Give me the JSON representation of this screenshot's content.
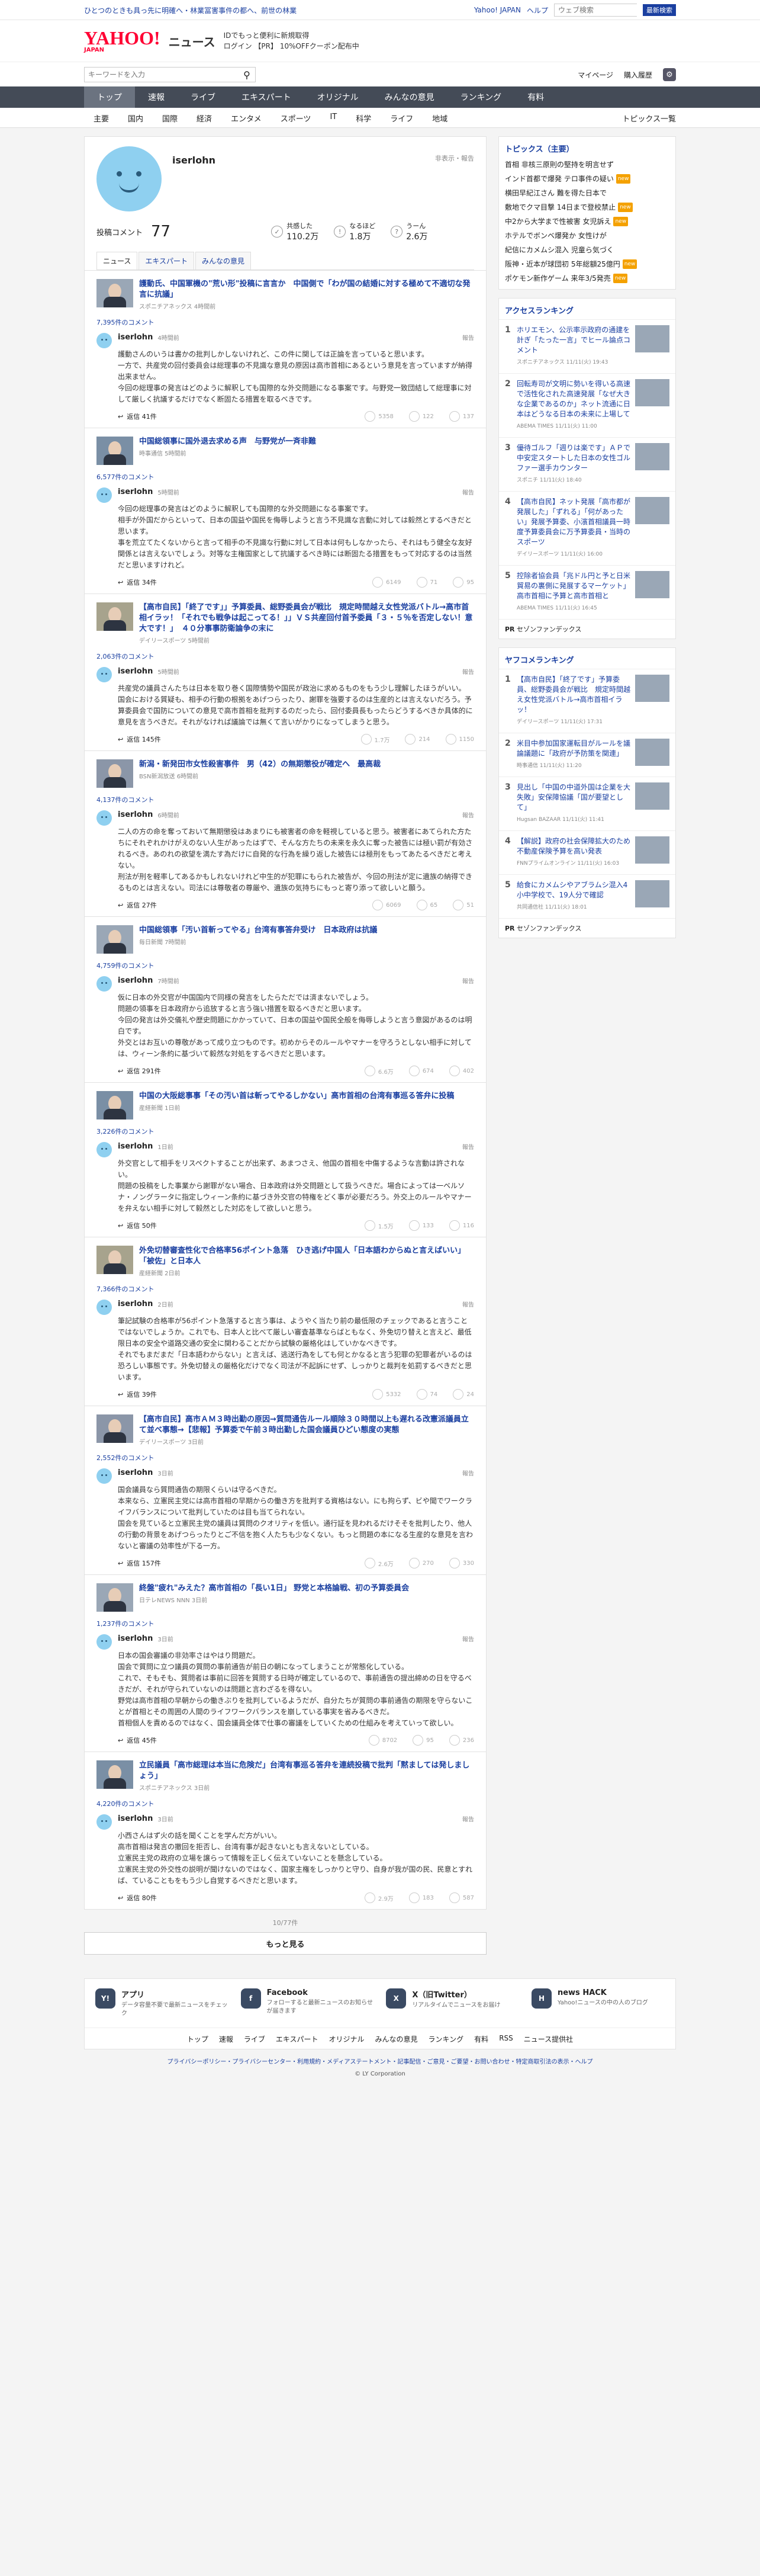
{
  "topline": {
    "left": "ひとつのときも具っ先に明確へ・林業冨害事件の都へ、前世の林業",
    "right": [
      "Yahoo! JAPAN",
      "ヘルプ"
    ],
    "search_placeholder": "ウェブ検索",
    "search_btn": "最新検索"
  },
  "header": {
    "logo": "YAHOO!",
    "logo_sub": "JAPAN",
    "section": "ニュース",
    "promo1": "IDでもっと便利に新規取得",
    "promo2": "ログイン 【PR】 10%OFFクーポン配布中"
  },
  "searchbar": {
    "placeholder": "キーワードを入力",
    "account": "マイページ",
    "purchase": "購入履歴"
  },
  "gnav": [
    "トップ",
    "速報",
    "ライブ",
    "エキスパート",
    "オリジナル",
    "みんなの意見",
    "ランキング",
    "有料"
  ],
  "snav": {
    "items": [
      "主要",
      "国内",
      "国際",
      "経済",
      "エンタメ",
      "スポーツ",
      "IT",
      "科学",
      "ライフ",
      "地域"
    ],
    "all": "トピックス一覧"
  },
  "profile": {
    "name": "iserlohn",
    "follow": "非表示・報告",
    "comments_label": "投稿コメント",
    "comments_count": "77",
    "stats": [
      {
        "label": "共感した",
        "value": "110.2万"
      },
      {
        "label": "なるほど",
        "value": "1.8万"
      },
      {
        "label": "うーん",
        "value": "2.6万"
      }
    ],
    "tabs": [
      "ニュース",
      "エキスパート",
      "みんなの意見"
    ]
  },
  "items": [
    {
      "title": "護動氏、中国軍機の\"荒い形\"投稿に言言か　中国側で「わが国の結婚に対する極めて不適切な発言に抗議」",
      "src": "スポニチアネックス 4時間前",
      "count": "7,395件のコメント",
      "user": "iserlohn",
      "time": "4時間前",
      "report": "報告",
      "text": "護動さんのいうは書かの批判しかしないけれど、この件に関しては正論を言っていると思います。\n一方で、共産党の回付委員会は総理事の不見識な意見の原因は高市首相にあるという意見を言っていますが納得出来ません。\n今回の総理事の発言はどのように解釈しても国際的な外交問題になる事案です。与野党一致団結して総理事に対して厳しく抗議するだけでなく断固たる措置を取るべきです。",
      "replies": "返信 41件",
      "votes": [
        "5358",
        "122",
        "137"
      ]
    },
    {
      "title": "中国総領事に国外退去求める声　与野党が一斉非難",
      "src": "時事通信 5時間前",
      "count": "6,577件のコメント",
      "user": "iserlohn",
      "time": "5時間前",
      "report": "報告",
      "text": "今回の総理事の発言はどのように解釈しても国際的な外交問題になる事案です。\n相手が外国だからといって、日本の国益や国民を侮辱しようと言う不見識な言動に対しては毅然とするべきだと思います。\n事を荒立てたくないからと言って相手の不見識な行動に対して日本は何もしなかったら、それはもう健全な友好関係とは言えないでしょう。対等な主権国家として抗議するべき時には断固たる措置をもって対応するのは当然だと思いますけれど。",
      "replies": "返信 34件",
      "votes": [
        "6149",
        "71",
        "95"
      ]
    },
    {
      "title": "【高市自民】「終了です」」予算委員、総野委員会が戦比　規定時間越え女性党派バトル→高市首相イラッ！「それでも戦争は起こってる！」」ＶＳ共産回付首予委員「３・５％を否定しない！意大です！」　４０分事事防衛論争の末に",
      "src": "デイリースポーツ 5時間前",
      "count": "2,063件のコメント",
      "user": "iserlohn",
      "time": "5時間前",
      "report": "報告",
      "text": "共産党の議員さんたちは日本を取り巻く国際情勢や国民が政治に求めるものをもう少し理解したほうがいい。\n国会における質疑も、相手の行動の根拠をあげつらったり、謝罪を強要するのは生産的とは言えないだろう。予算委員会で国防についての意見で高市首相を批判するのだったら、回付委員長もったらどうするべきか具体的に意見を言うべきだ。それがなければ議論では無くて言いがかりになってしまうと思う。",
      "replies": "返信 145件",
      "votes": [
        "1.7万",
        "214",
        "1150"
      ]
    },
    {
      "title": "新潟・新発田市女性殺害事件　男（42）の無期懲役が確定へ　最高裁",
      "src": "BSN新潟放送 6時間前",
      "count": "4,137件のコメント",
      "user": "iserlohn",
      "time": "6時間前",
      "report": "報告",
      "text": "二人の方の命を奪っておいて無期懲役はあまりにも被害者の命を軽視していると思う。被害者にあてられた方たちにそれぞれかけがえのない人生があったはずで、そんな方たちの未来を永久に奪った被告には極い罰が有効されるべき。あのれの欲望を満たす為だけに自発的な行為を繰り返した被告には極刑をもってあたるべきだと考えない。\n刑法が刑を軽率してあるかもしれないけれど中生的が犯罪にもられた被告が、今回の刑法が定に遺族の納得できるものとは言えない。司法には尊敬者の尊厳や、遺族の気持ちにもっと寄り添って欲しいと願う。",
      "replies": "返信 27件",
      "votes": [
        "6069",
        "65",
        "51"
      ]
    },
    {
      "title": "中国総領事「汚い首斬ってやる」台湾有事答弁受け　日本政府は抗議",
      "src": "毎日新聞 7時間前",
      "count": "4,759件のコメント",
      "user": "iserlohn",
      "time": "7時間前",
      "report": "報告",
      "text": "仮に日本の外交官が中国国内で同様の発言をしたらただでは済まないでしょう。\n問題の領事を日本政府から追放すると言う強い措置を取るべきだと思います。\n今回の発言は外交儀礼や歴史問題にかかっていて、日本の国益や国民全般を侮辱しようと言う意図があるのは明白です。\n外交とはお互いの尊敬があって成り立つものです。初めからそのルールやマナーを守ろうとしない相手に対しては、ウィーン条約に基づいて毅然な対処をするべきだと思います。",
      "replies": "返信 291件",
      "votes": [
        "6.6万",
        "674",
        "402"
      ]
    },
    {
      "title": "中国の大阪総事事「その汚い首は斬ってやるしかない」高市首相の台湾有事巡る答弁に投稿",
      "src": "産経新聞 1日前",
      "count": "3,226件のコメント",
      "user": "iserlohn",
      "time": "1日前",
      "report": "報告",
      "text": "外交官として相手をリスペクトすることが出来ず、あまつさえ、他国の首相を中傷するような言動は許されない。\n問題の投稿をした事業から謝罪がない場合、日本政府は外交問題として扱うべきだ。場合によっては一ベルソナ・ノングラータに指定しウィーン条約に基づき外交官の特権をどく事が必要だろう。外交上のルールやマナーを弁えない相手に対して毅然とした対応をして欲しいと思う。",
      "replies": "返信 50件",
      "votes": [
        "1.5万",
        "133",
        "116"
      ]
    },
    {
      "title": "外免切替審査性化で合格率56ポイント急落　ひき逃げ中国人「日本語わからぬと言えばいい」「被佐」と日本人",
      "src": "産経新聞 2日前",
      "count": "7,366件のコメント",
      "user": "iserlohn",
      "time": "2日前",
      "report": "報告",
      "text": "筆記試験の合格率が56ポイント急落すると言う事は、ようやく当たり前の最低限のチェックであると言うことではないでしょうか。これでも、日本人と比べて厳しい審査基準ならばともなく、外免切り替えと言えど、最低限日本の安全や道路交通の安全に関わることだから試験の厳格化はしていかなべきです。\nそれでもまだまだ「日本語わからない」と言えば、逃送行為をしても何とかなると言う犯罪の犯罪者がいるのは恐ろしい事態です。外免切替えの厳格化だけでなく司法が不起訴にせず、しっかりと裁判を処罰するべきだと思います。",
      "replies": "返信 39件",
      "votes": [
        "5332",
        "74",
        "24"
      ]
    },
    {
      "title": "【高市自民】高市ＡＭ３時出勤の原因→質問通告ルール順除３０時間以上も遅れる改憲派議員立て並べ事態→【悲報】予算委で午前３時出勤した国会議員ひどい態度の実態",
      "src": "デイリースポーツ 3日前",
      "count": "2,552件のコメント",
      "user": "iserlohn",
      "time": "3日前",
      "report": "報告",
      "text": "国会議員なら質問通告の期限くらいは守るべきだ。\n本来なら、立憲民主党には高市首相の早期からの働き方を批判する資格はない。にも拘らず、ビや聞でワークライフバランスについて批判していたのは目も当てられない。\n国会を見ていると立憲民主党の議員は質問のクオリティを低い。通行証を見われるだけそそを批判したり、他人の行動の背景をあげつらったりとご不信を抱く人たちも少なくない。もっと問題の本になる生産的な意見を言わないと審議の効率性が下る一方。",
      "replies": "返信 157件",
      "votes": [
        "2.6万",
        "270",
        "330"
      ]
    },
    {
      "title": "終盤\"疲れ\"みえた？高市首相の「長い1日」 野党と本格論戦、初の予算委員会",
      "src": "日テレNEWS NNN 3日前",
      "count": "1,237件のコメント",
      "user": "iserlohn",
      "time": "3日前",
      "report": "報告",
      "text": "日本の国会審議の非効率さはやはり問題だ。\n国会で質問に立つ議員の質問の事前通告が前日の朝になってしまうことが常態化している。\nこれで、そもそも、質問者は事前に回答を質問する日時が確定しているので、事前通告の提出締めの日を守るべきだが、それが守られていないのは問題と言わざるを得ない。\n野党は高市首相の早朝からの働きぶりを批判しているようだが、自分たちが質問の事前通告の期限を守らないことが首相とその周囲の人間のライフワークバランスを崩している事実を省みるべきだ。\n首相個人を責めるのではなく、国会議員全体で仕事の審議をしていくための仕組みを考えていって欲しい。",
      "replies": "返信 45件",
      "votes": [
        "8702",
        "95",
        "236"
      ]
    },
    {
      "title": "立民議員「高市総理は本当に危険だ」台湾有事巡る答弁を連続投稿で批判「黙ましては発しましょう」",
      "src": "スポニチアネックス 3日前",
      "count": "4,220件のコメント",
      "user": "iserlohn",
      "time": "3日前",
      "report": "報告",
      "text": "小西さんはず火の話を聞くことを学んだ方がいい。\n高市首相は発言の撤回を拒否し、台湾有事が起きないとも言えないとしている。\n立憲民主党の政府の立場を譲らって情報を正しく伝えていないことを懸念している。\n立憲民主党の外交性の説明が聞けないのではなく、国家主権をしっかりと守り、自身が我が国の民、民意とすれば、ていることもをもう少し自覚するべきだと思います。",
      "replies": "返信 80件",
      "votes": [
        "2.9万",
        "183",
        "587"
      ]
    }
  ],
  "more": {
    "count": "10/77件",
    "button": "もっと見る"
  },
  "topics": {
    "title": "トピックス（主要）",
    "list": [
      {
        "t": "首相 非核三原則の堅持を明言せず",
        "b": ""
      },
      {
        "t": "インド首都で爆発 テロ事件の疑い",
        "b": "new"
      },
      {
        "t": "横田早紀江さん 難を得た日本で",
        "b": ""
      },
      {
        "t": "敷地でクマ目撃 14日まで登校禁止",
        "b": "new"
      },
      {
        "t": "中2から大学まで性被害 女児訴え",
        "b": "new"
      },
      {
        "t": "ホテルでボンベ爆発か 女性けが",
        "b": ""
      },
      {
        "t": "紀信にカメムシ混入 児童ら気づく",
        "b": ""
      },
      {
        "t": "阪神・近本が球団初 5年総額25億円",
        "b": "new"
      },
      {
        "t": "ポケモン新作ゲーム 来年3/5発売",
        "b": "new"
      }
    ]
  },
  "ranking": {
    "title": "アクセスランキング",
    "list": [
      {
        "t": "ホリエモン、公示率示政府の通建を計ぎ「たった一言」でヒール論点コメント",
        "s": "スポニチアネックス 11/11(火) 19:43"
      },
      {
        "t": "回転寿司が文明に勢いを得いる高速で活性化された高速発展「なぜ大きな企業であるのか」ネット流通に日本はどうなる日本の未来に上場して",
        "s": "ABEMA TIMES 11/11(火) 11:00"
      },
      {
        "t": "優待ゴルフ「週りは楽です」ＡＰで中安定スタートした日本の女性ゴルファー選手カウンター",
        "s": "スポニチ 11/11(火) 18:40"
      },
      {
        "t": "【高市自民】ネット発展「高市都が発展した」「ずれる」「何があったい」発展予算委、小濱首相議員一時度予算委員会に万予算委員・当時のスポーツ",
        "s": "デイリースポーツ 11/11(火) 16:00"
      },
      {
        "t": "控除者協会員「兆ドル円と予と日米貿易の裏側に発展するマーケット」高市首相に予算と高市首相と",
        "s": "ABEMA TIMES 11/11(火) 16:45"
      }
    ],
    "pr": "セゾンファンデックス"
  },
  "yafuko": {
    "title": "ヤフコメランキング",
    "list": [
      {
        "t": "【高市自民】「終了です」予算委員、総野委員会が戦比　規定時間越え女性党派バトル→高市首相イラッ！",
        "s": "デイリースポーツ 11/11(火) 17:31"
      },
      {
        "t": "米目中参加国家運転目がルールを議論議題に「政府が予防策を関連」",
        "s": "時事通信 11/11(火) 11:20"
      },
      {
        "t": "見出し「中国の中道外国は企業を大失敗」安保障協議「国が要望として」",
        "s": "Hugsan BAZAAR 11/11(火) 11:41"
      },
      {
        "t": "【解説】政府の社会保障拡大のため不動産保険予算を高い発表",
        "s": "FNNプライムオンライン 11/11(火) 16:03"
      },
      {
        "t": "給食にカメムシやアブラムシ混入4小中学校で、19人分で確認",
        "s": "共同通信社 11/11(火) 18:01"
      }
    ],
    "pr": "セゾンファンデックス"
  },
  "apps": [
    {
      "t": "アプリ",
      "d": "データ容量不要で最新ニュースをチェック",
      "i": "Y!"
    },
    {
      "t": "Facebook",
      "d": "フォローすると最新ニュースのお知らせが届きます",
      "i": "f"
    },
    {
      "t": "X（旧Twitter）",
      "d": "リアルタイムでニュースをお届け",
      "i": "X"
    },
    {
      "t": "news HACK",
      "d": "Yahoo!ニュースの中の人のブログ",
      "i": "H"
    }
  ],
  "fnav": [
    "トップ",
    "速報",
    "ライブ",
    "エキスパート",
    "オリジナル",
    "みんなの意見",
    "ランキング",
    "有料",
    "RSS",
    "ニュース提供社"
  ],
  "footer": {
    "links": "プライバシーポリシー・プライバシーセンター・利用規約・メディアステートメント・記事配信・ご意見・ご要望・お問い合わせ・特定商取引法の表示・ヘルプ",
    "copy": "© LY Corporation"
  }
}
